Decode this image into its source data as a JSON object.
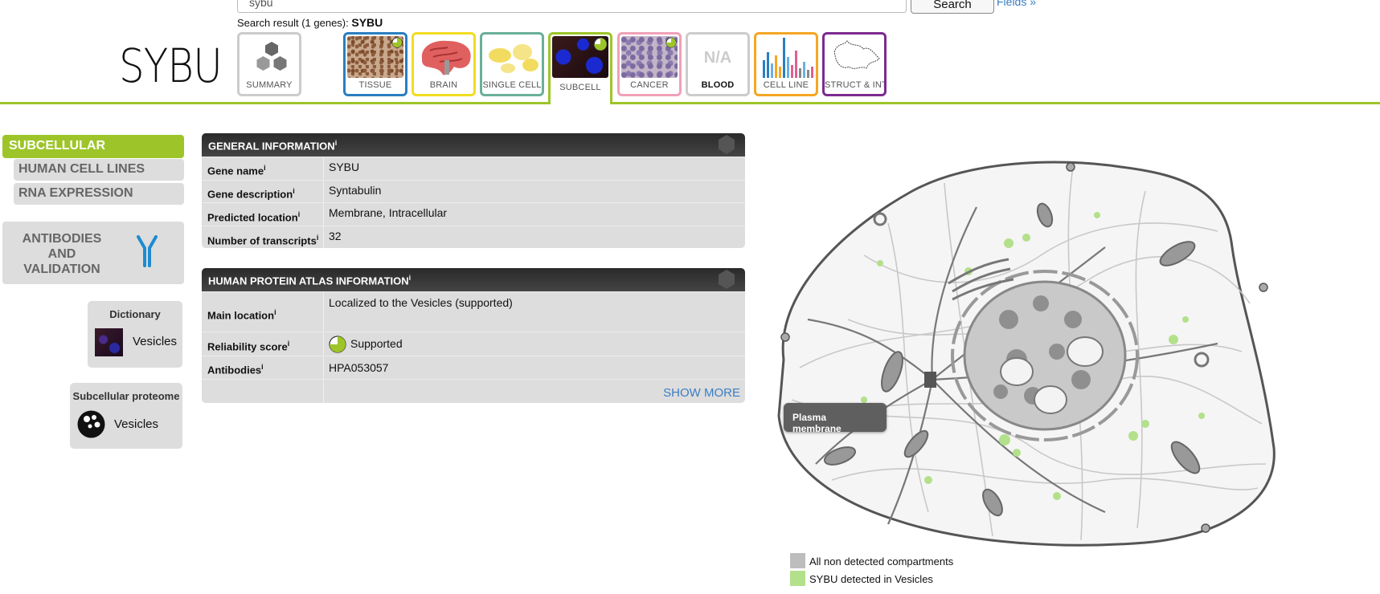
{
  "search": {
    "value": "sybu",
    "button_label": "Search",
    "fields_link": "Fields »"
  },
  "search_result": {
    "prefix": "Search result (1 genes):",
    "gene": "SYBU"
  },
  "gene_title": "SYBU",
  "tabs": [
    {
      "label": "SUMMARY",
      "color": "#c8c8c8"
    },
    {
      "label": "TISSUE",
      "color": "#2a7fc0"
    },
    {
      "label": "BRAIN",
      "color": "#f2dc22"
    },
    {
      "label": "SINGLE CELL",
      "color": "#6aaf9a"
    },
    {
      "label": "SUBCELL",
      "color": "#9dc529"
    },
    {
      "label": "CANCER",
      "color": "#f0a0b8"
    },
    {
      "label": "BLOOD",
      "color": "#c8c8c8",
      "thumb_text": "N/A"
    },
    {
      "label": "CELL LINE",
      "color": "#f5a623"
    },
    {
      "label": "STRUCT & INT",
      "color": "#7b2a90"
    }
  ],
  "nav": {
    "active": "SUBCELLULAR",
    "sub": [
      "HUMAN CELL LINES",
      "RNA EXPRESSION"
    ],
    "antibodies": "ANTIBODIES AND VALIDATION"
  },
  "dictionary": {
    "title": "Dictionary",
    "item": "Vesicles"
  },
  "subcellular_proteome": {
    "title": "Subcellular proteome",
    "item": "Vesicles"
  },
  "general_info": {
    "title": "GENERAL INFORMATION",
    "rows": [
      {
        "key": "Gene name",
        "value": "SYBU"
      },
      {
        "key": "Gene description",
        "value": "Syntabulin"
      },
      {
        "key": "Predicted location",
        "value": "Membrane, Intracellular"
      },
      {
        "key": "Number of transcripts",
        "value": "32"
      }
    ]
  },
  "hpa_info": {
    "title": "HUMAN PROTEIN ATLAS INFORMATION",
    "rows": [
      {
        "key": "Main location",
        "value": "Localized to the Vesicles (supported)"
      },
      {
        "key": "Reliability score",
        "value": "Supported"
      },
      {
        "key": "Antibodies",
        "value": "HPA053057"
      }
    ],
    "show_more": "SHOW MORE"
  },
  "info_marker": "i",
  "tooltip": "Plasma membrane",
  "legend": [
    {
      "label": "All non detected compartments",
      "color": "#bdbdbd"
    },
    {
      "label": "SYBU detected in Vesicles",
      "color": "#b3e08a"
    }
  ],
  "colors": {
    "accent": "#9dc529",
    "link": "#3b7dc4",
    "header": "#333333"
  }
}
